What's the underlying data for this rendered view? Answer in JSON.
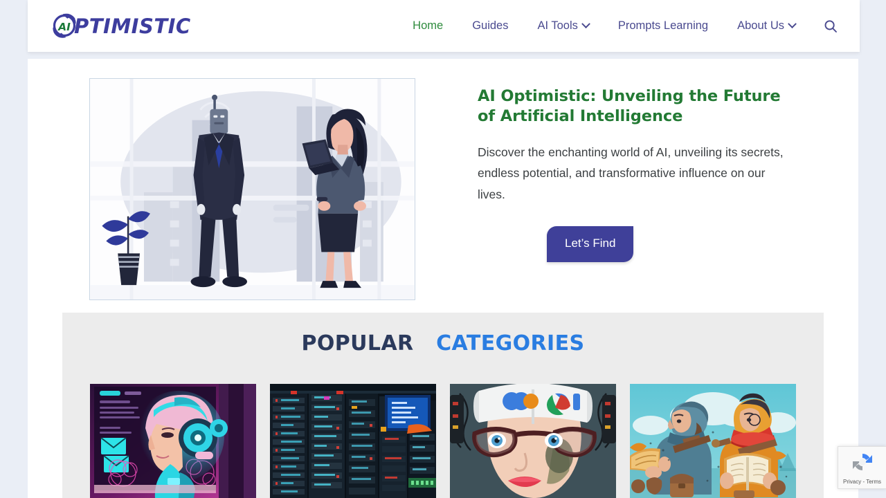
{
  "site": {
    "background_color": "#eaeef6",
    "logo": {
      "mark_text": "AI",
      "mark_color": "#1c7a3a",
      "ring_color": "#3d3d9e",
      "word": "PTIMISTIC",
      "word_color": "#3d3d9e"
    }
  },
  "header": {
    "nav": [
      {
        "label": "Home",
        "active": true,
        "has_dropdown": false
      },
      {
        "label": "Guides",
        "active": false,
        "has_dropdown": false
      },
      {
        "label": "AI Tools",
        "active": false,
        "has_dropdown": true
      },
      {
        "label": "Prompts Learning",
        "active": false,
        "has_dropdown": false
      },
      {
        "label": "About Us",
        "active": false,
        "has_dropdown": true
      }
    ],
    "search_icon": "search-icon",
    "active_color": "#2e8b3d",
    "link_color": "#4a4a8f"
  },
  "hero": {
    "image_alt": "Illustration of a robot in a business suit standing beside a businesswoman holding a laptop",
    "title": "AI Optimistic: Unveiling the Future of Artificial Intelligence",
    "title_color": "#237a34",
    "description": "Discover the enchanting world of AI, unveiling its secrets, endless potential, and transformative influence on our lives.",
    "cta_label": "Let’s Find",
    "cta_bg": "#3f4099",
    "cta_text_color": "#ffffff"
  },
  "categories": {
    "heading_part_1": "POPULAR",
    "heading_part_2": "CATEGORIES",
    "heading_color_1": "#2b3a5c",
    "heading_color_2": "#2a7de1",
    "band_bg": "#ececec",
    "cards": [
      {
        "name": "cyber-robot-woman-headphones",
        "alt": "Neon pink and cyan cyberpunk robot woman wearing headphones"
      },
      {
        "name": "server-room-racks",
        "alt": "Dark data center with illuminated server racks"
      },
      {
        "name": "woman-glasses-ai-helmet",
        "alt": "Woman in large glasses wearing a white helmet with colorful AI letters"
      },
      {
        "name": "two-travelers-reading-books",
        "alt": "Two illustrated hooded travelers reading open books outdoors"
      }
    ]
  },
  "recaptcha": {
    "label": "Privacy - Terms",
    "icon": "recaptcha-icon"
  }
}
